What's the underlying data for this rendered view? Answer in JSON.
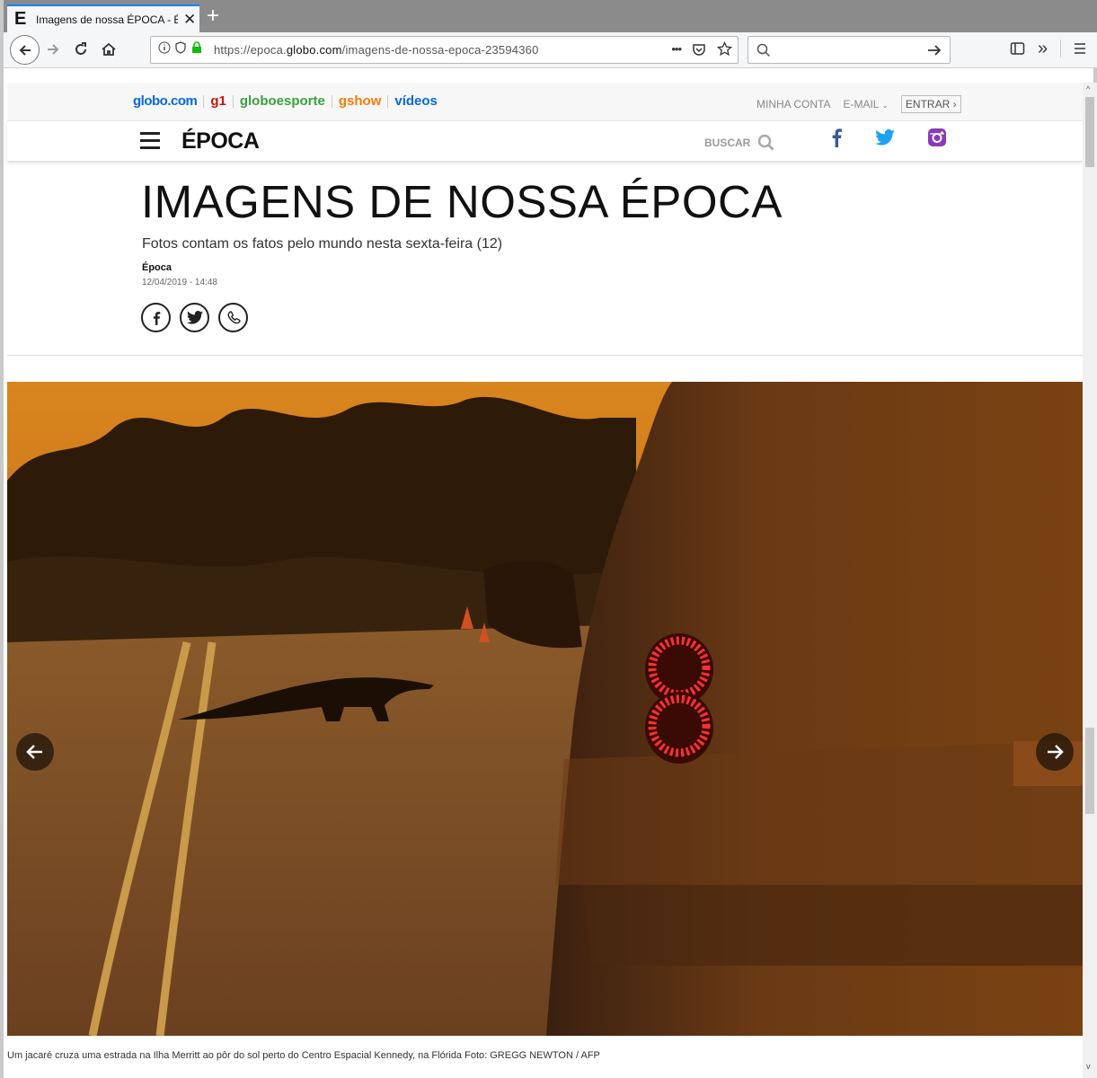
{
  "browser": {
    "tab_title": "Imagens de nossa ÉPOCA - Épc",
    "tab_favicon": "E",
    "url_prefix": "https://epoca.",
    "url_domain": "globo.com",
    "url_path": "/imagens-de-nossa-epoca-23594360",
    "url_more": "•••"
  },
  "globo_bar": {
    "links": [
      {
        "label": "globo.com",
        "color": "#0669de"
      },
      {
        "label": "g1",
        "color": "#c4170c"
      },
      {
        "label": "globoesporte",
        "color": "#39a03d"
      },
      {
        "label": "gshow",
        "color": "#f67b0c"
      },
      {
        "label": "vídeos",
        "color": "#0669de"
      }
    ],
    "minha_conta": "MINHA CONTA",
    "email": "E-MAIL",
    "entrar": "ENTRAR ›"
  },
  "header": {
    "logo": "ÉPOCA",
    "buscar": "BUSCAR",
    "social_colors": {
      "facebook": "#3b5998",
      "twitter": "#1da1f2",
      "instagram": "#8a3ab9"
    }
  },
  "article": {
    "title": "IMAGENS DE NOSSA ÉPOCA",
    "subtitle": "Fotos contam os fatos pelo mundo nesta sexta-feira (12)",
    "author": "Época",
    "date": "12/04/2019 - 14:48",
    "caption": "Um jacaré cruza uma estrada na Ilha Merritt ao pôr do sol perto do Centro Espacial Kennedy, na Flórida Foto: GREGG NEWTON / AFP"
  }
}
